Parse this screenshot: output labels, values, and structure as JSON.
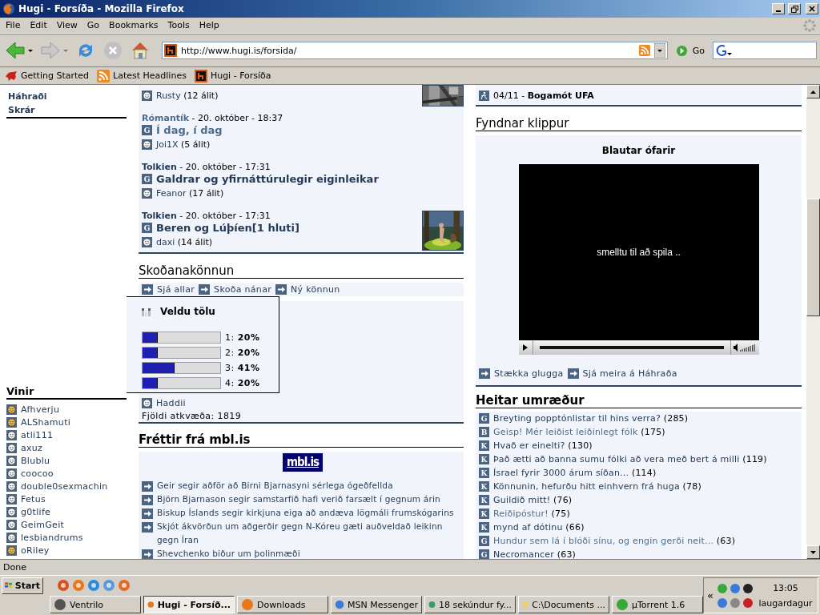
{
  "window": {
    "title": "Hugi - Forsíða - Mozilla Firefox"
  },
  "menu": [
    "File",
    "Edit",
    "View",
    "Go",
    "Bookmarks",
    "Tools",
    "Help"
  ],
  "toolbar": {
    "url": "http://www.hugi.is/forsida/",
    "go": "Go"
  },
  "bookmarks": [
    {
      "label": "Getting Started",
      "kind": "firefox"
    },
    {
      "label": "Latest Headlines",
      "kind": "rss"
    },
    {
      "label": "Hugi - Forsíða",
      "kind": "site"
    }
  ],
  "sidebar": {
    "links": [
      "Háhraði",
      "Skrár"
    ],
    "friends_title": "Vinir",
    "friends": [
      {
        "name": "Afhverju",
        "online": true
      },
      {
        "name": "ALShamuti",
        "online": true
      },
      {
        "name": "atli111",
        "online": false
      },
      {
        "name": "axuz",
        "online": false
      },
      {
        "name": "Blublu",
        "online": false
      },
      {
        "name": "coocoo",
        "online": false
      },
      {
        "name": "double0sexmachin",
        "online": false
      },
      {
        "name": "Fetus",
        "online": false
      },
      {
        "name": "g0tlife",
        "online": false
      },
      {
        "name": "GeimGeit",
        "online": false
      },
      {
        "name": "lesbiandrums",
        "online": false
      },
      {
        "name": "oRiley",
        "online": true
      }
    ]
  },
  "articles": [
    {
      "author": "Rusty",
      "comments": "(12 álit)",
      "thumbnail": true
    },
    {
      "category": "Rómantík",
      "date": "- 20. október - 18:37",
      "badge": "G",
      "title": "Í dag, í dag",
      "author": "Joi1X",
      "comments": "(5 álit)",
      "visited": true,
      "thumbnail": false
    },
    {
      "category": "Tolkien",
      "date": "- 20. október - 17:31",
      "badge": "G",
      "title": "Galdrar og yfirnáttúrulegir eiginleikar",
      "author": "Feanor",
      "comments": "(17 álit)",
      "visited": false,
      "thumbnail": false
    },
    {
      "category": "Tolkien",
      "date": "- 20. október - 17:31",
      "badge": "G",
      "title": "Beren og Lúþíen[1 hluti]",
      "author": "daxi",
      "comments": "(14 álit)",
      "visited": false,
      "thumbnail": true
    }
  ],
  "poll": {
    "heading": "Skoðanakönnun",
    "links": [
      "Sjá allar",
      "Skoða nánar",
      "Ný könnun"
    ],
    "title": "Veldu tölu",
    "options": [
      {
        "number": "1:",
        "percent": "20%",
        "level": 0.2
      },
      {
        "number": "2:",
        "percent": "20%",
        "level": 0.2
      },
      {
        "number": "3:",
        "percent": "41%",
        "level": 0.41
      },
      {
        "number": "4:",
        "percent": "20%",
        "level": 0.2
      }
    ],
    "author": "Haddii",
    "votes": "Fjöldi atkvæða: 1819"
  },
  "news": {
    "heading": "Fréttir frá mbl.is",
    "logo": "mbl.is",
    "items": [
      "Geir segir aðför að Birni Bjarnasyni sérlega ógeðfellda",
      "Björn Bjarnason segir samstarfið hafi verið farsælt í gegnum árin",
      "Biskup Íslands segir kirkjuna eiga að andæva lögmáli frumskógarins",
      "Skjót ákvörðun um aðgerðir gegn N-Kóreu gæti auðveldað leikinn gegn Íran",
      "Shevchenko biður um þolinmæði"
    ]
  },
  "event": {
    "text": "04/11 - **Bogamót UFA**"
  },
  "clips": {
    "heading": "Fyndnar klippur",
    "title": "Blautar ófarir",
    "overlay": "smelltu til að spila ..",
    "progress": {
      "level": 0
    },
    "links": [
      "Stækka glugga",
      "Sjá meira á Háhraða"
    ]
  },
  "hot": {
    "heading": "Heitar umræður",
    "items": [
      {
        "badge": "G",
        "title": "Breyting popptónlistar til hins verra?",
        "count": "(285)",
        "visited": false
      },
      {
        "badge": "B",
        "title": "Geisp! Mér leiðist leiðinlegt fólk",
        "count": "(175)",
        "visited": true
      },
      {
        "badge": "K",
        "title": "Hvað er einelti?",
        "count": "(130)",
        "visited": false
      },
      {
        "badge": "K",
        "title": "Það ætti að banna sumu fólki að vera með bert á milli",
        "count": "(119)",
        "visited": false
      },
      {
        "badge": "K",
        "title": "Ísrael fyrir 3000 árum síðan...",
        "count": "(114)",
        "visited": false
      },
      {
        "badge": "K",
        "title": "Könnunin, hefurðu hitt einhvern frá huga",
        "count": "(78)",
        "visited": false
      },
      {
        "badge": "K",
        "title": "Guildið mitt!",
        "count": "(76)",
        "visited": false
      },
      {
        "badge": "K",
        "title": "Reiðipóstur!",
        "count": "(75)",
        "visited": true
      },
      {
        "badge": "K",
        "title": "mynd af dótinu",
        "count": "(66)",
        "visited": false
      },
      {
        "badge": "G",
        "title": "Hundur sem lá í blóði sínu, og engin gerði neit...",
        "count": "(63)",
        "visited": true
      },
      {
        "badge": "G",
        "title": "Necromancer",
        "count": "(63)",
        "visited": false
      }
    ]
  },
  "status": "Done",
  "taskbar": {
    "start": "Start",
    "tasks": [
      {
        "label": "Ventrilo",
        "selected": false
      },
      {
        "label": "Hugi - Forsíð...",
        "selected": true
      },
      {
        "label": "Downloads",
        "selected": false
      },
      {
        "label": "MSN Messenger",
        "selected": false
      },
      {
        "label": "18 sekúndur fy...",
        "selected": false
      },
      {
        "label": "C:\\Documents ...",
        "selected": false
      },
      {
        "label": "µTorrent 1.6",
        "selected": false
      }
    ],
    "tray_toggle": "«",
    "time": "13:05",
    "day": "laugardagur"
  }
}
